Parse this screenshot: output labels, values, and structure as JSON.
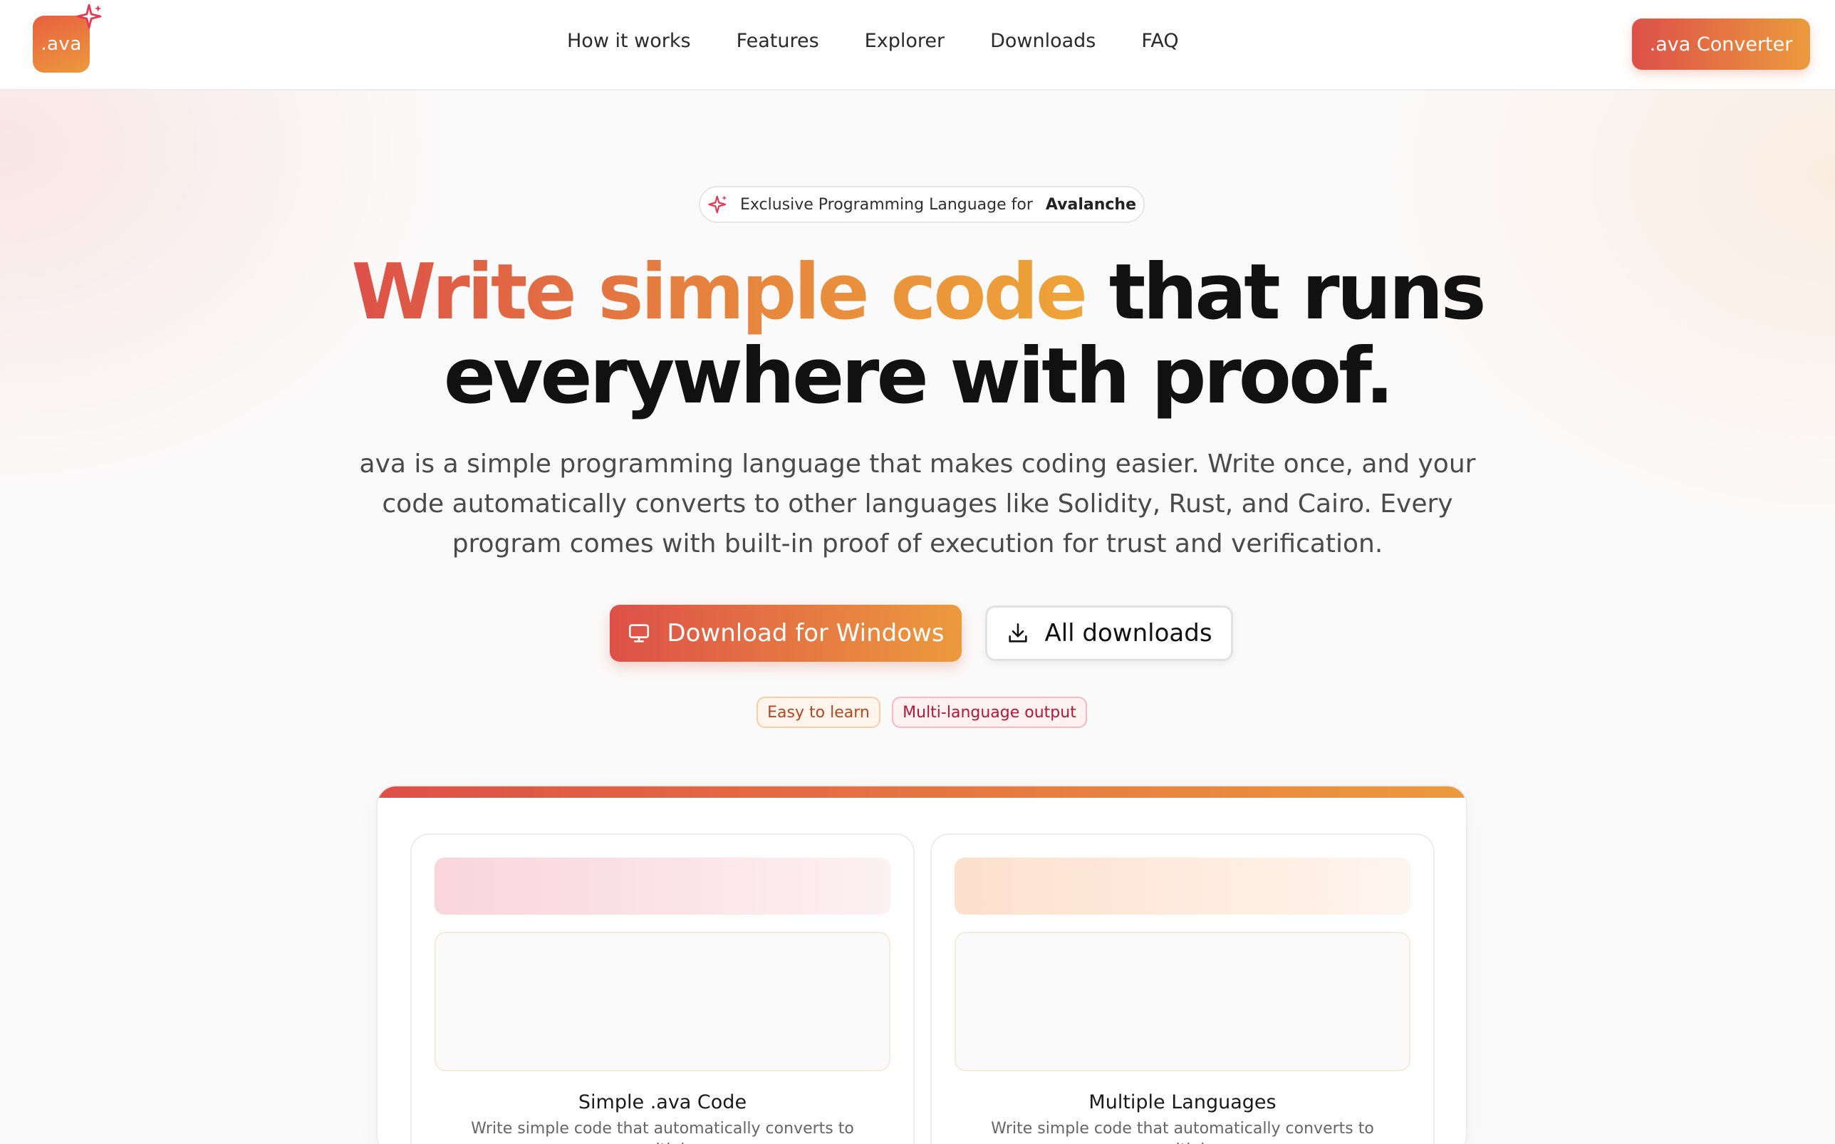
{
  "brand": {
    "logo_text": ".ava",
    "accent_start": "#dd5048",
    "accent_end": "#ec9a3d"
  },
  "nav": {
    "links": [
      "How it works",
      "Features",
      "Explorer",
      "Downloads",
      "FAQ"
    ],
    "cta_label": ".ava Converter"
  },
  "hero": {
    "badge_prefix": "Exclusive Programming Language for",
    "badge_strong": "Avalanche",
    "headline_gradient": "Write simple code",
    "headline_rest_line1": "that runs",
    "headline_line2": "everywhere with proof.",
    "subtitle": "ava is a simple programming language that makes coding easier. Write once, and your code automatically converts to other languages like Solidity, Rust, and Cairo. Every program comes with built-in proof of execution for trust and verification.",
    "primary_button": "Download for Windows",
    "primary_icon": "monitor-icon",
    "secondary_button": "All downloads",
    "secondary_icon": "download-icon",
    "tags": [
      "Easy to learn",
      "Multi-language output"
    ]
  },
  "features": [
    {
      "title": "Simple .ava Code",
      "description": "Write simple code that automatically converts to multiple"
    },
    {
      "title": "Multiple Languages",
      "description": "Write simple code that automatically converts to multiple"
    }
  ]
}
